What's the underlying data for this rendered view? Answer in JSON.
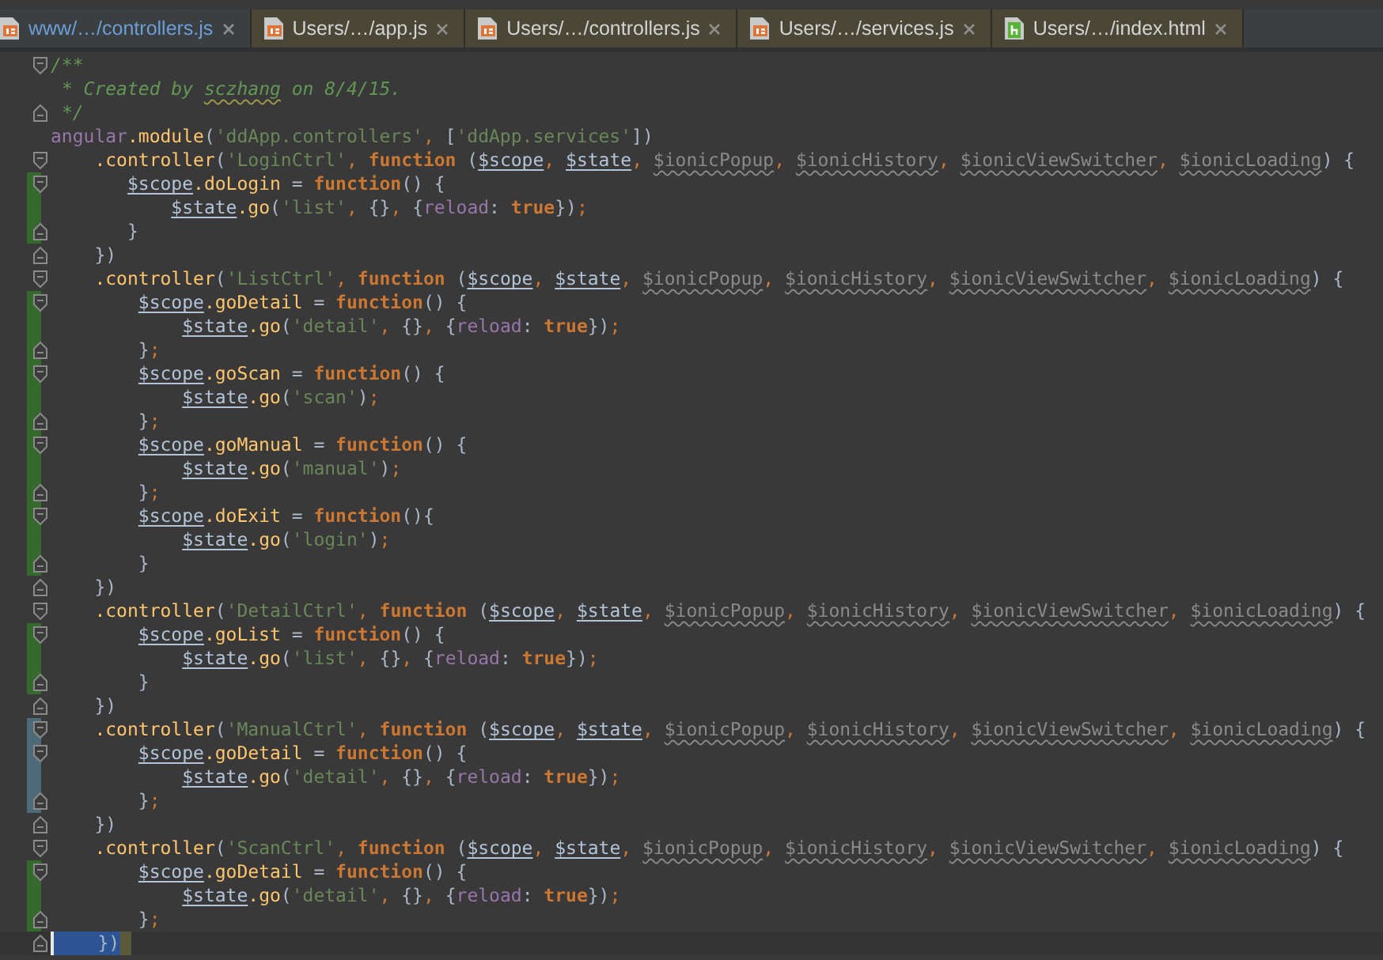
{
  "tabs": [
    {
      "label": "www/…/controllers.js",
      "kind": "js",
      "selected": true
    },
    {
      "label": "Users/…/app.js",
      "kind": "js",
      "selected": false
    },
    {
      "label": "Users/…/controllers.js",
      "kind": "js",
      "selected": false
    },
    {
      "label": "Users/…/services.js",
      "kind": "js",
      "selected": false
    },
    {
      "label": "Users/…/index.html",
      "kind": "html",
      "selected": false
    }
  ],
  "lines": [
    {
      "fold_start": true,
      "selected": false,
      "tokens": [
        {
          "kind": "comment",
          "text": "/**"
        }
      ]
    },
    {
      "selected": false,
      "tokens": [
        {
          "kind": "comment",
          "text": " * Created by "
        },
        {
          "kind": "typo",
          "text": "sczhang"
        },
        {
          "kind": "comment",
          "text": " on 8/4/15."
        }
      ]
    },
    {
      "fold_end": true,
      "selected": false,
      "tokens": [
        {
          "kind": "comment",
          "text": " */"
        }
      ]
    },
    {
      "selected": false,
      "tokens": [
        {
          "kind": "global",
          "text": "angular"
        },
        {
          "kind": "member",
          "text": ".module"
        },
        {
          "kind": "plain",
          "text": "("
        },
        {
          "kind": "string",
          "text": "'ddApp.controllers'"
        },
        {
          "kind": "punct",
          "text": ", "
        },
        {
          "kind": "plain",
          "text": "["
        },
        {
          "kind": "string",
          "text": "'ddApp.services'"
        },
        {
          "kind": "plain",
          "text": "])"
        }
      ]
    },
    {
      "fold_start": true,
      "selected": false,
      "tokens": [
        {
          "kind": "member",
          "text": "    .controller"
        },
        {
          "kind": "plain",
          "text": "("
        },
        {
          "kind": "string",
          "text": "'LoginCtrl'"
        },
        {
          "kind": "punct",
          "text": ", "
        },
        {
          "kind": "keyword",
          "text": "function"
        },
        {
          "kind": "plain",
          "text": " ("
        },
        {
          "kind": "param",
          "text": "$scope"
        },
        {
          "kind": "punct",
          "text": ", "
        },
        {
          "kind": "param",
          "text": "$state"
        },
        {
          "kind": "punct",
          "text": ", "
        },
        {
          "kind": "unused",
          "text": "$ionicPopup"
        },
        {
          "kind": "punct",
          "text": ", "
        },
        {
          "kind": "unused",
          "text": "$ionicHistory"
        },
        {
          "kind": "punct",
          "text": ", "
        },
        {
          "kind": "unused",
          "text": "$ionicViewSwitcher"
        },
        {
          "kind": "punct",
          "text": ", "
        },
        {
          "kind": "unused",
          "text": "$ionicLoading"
        },
        {
          "kind": "plain",
          "text": ") {"
        }
      ]
    },
    {
      "fold_start": true,
      "added": true,
      "selected": false,
      "tokens": [
        {
          "kind": "param",
          "text": "       $scope"
        },
        {
          "kind": "member",
          "text": ".doLogin"
        },
        {
          "kind": "plain",
          "text": " = "
        },
        {
          "kind": "keyword",
          "text": "function"
        },
        {
          "kind": "plain",
          "text": "() {"
        }
      ]
    },
    {
      "added": true,
      "selected": false,
      "tokens": [
        {
          "kind": "param",
          "text": "           $state"
        },
        {
          "kind": "member",
          "text": ".go"
        },
        {
          "kind": "plain",
          "text": "("
        },
        {
          "kind": "string",
          "text": "'list'"
        },
        {
          "kind": "punct",
          "text": ", "
        },
        {
          "kind": "plain",
          "text": "{}"
        },
        {
          "kind": "punct",
          "text": ", "
        },
        {
          "kind": "plain",
          "text": "{"
        },
        {
          "kind": "field",
          "text": "reload"
        },
        {
          "kind": "plain",
          "text": ": "
        },
        {
          "kind": "keyword",
          "text": "true"
        },
        {
          "kind": "plain",
          "text": "})"
        },
        {
          "kind": "punct",
          "text": ";"
        }
      ]
    },
    {
      "fold_end": true,
      "added": true,
      "selected": false,
      "tokens": [
        {
          "kind": "plain",
          "text": "       }"
        }
      ]
    },
    {
      "fold_end": true,
      "selected": false,
      "tokens": [
        {
          "kind": "plain",
          "text": "    })"
        }
      ]
    },
    {
      "fold_start": true,
      "selected": false,
      "tokens": [
        {
          "kind": "member",
          "text": "    .controller"
        },
        {
          "kind": "plain",
          "text": "("
        },
        {
          "kind": "string",
          "text": "'ListCtrl'"
        },
        {
          "kind": "punct",
          "text": ", "
        },
        {
          "kind": "keyword",
          "text": "function"
        },
        {
          "kind": "plain",
          "text": " ("
        },
        {
          "kind": "param",
          "text": "$scope"
        },
        {
          "kind": "punct",
          "text": ", "
        },
        {
          "kind": "param",
          "text": "$state"
        },
        {
          "kind": "punct",
          "text": ", "
        },
        {
          "kind": "unused",
          "text": "$ionicPopup"
        },
        {
          "kind": "punct",
          "text": ", "
        },
        {
          "kind": "unused",
          "text": "$ionicHistory"
        },
        {
          "kind": "punct",
          "text": ", "
        },
        {
          "kind": "unused",
          "text": "$ionicViewSwitcher"
        },
        {
          "kind": "punct",
          "text": ", "
        },
        {
          "kind": "unused",
          "text": "$ionicLoading"
        },
        {
          "kind": "plain",
          "text": ") {"
        }
      ]
    },
    {
      "fold_start": true,
      "added": true,
      "selected": false,
      "tokens": [
        {
          "kind": "param",
          "text": "        $scope"
        },
        {
          "kind": "member",
          "text": ".goDetail"
        },
        {
          "kind": "plain",
          "text": " = "
        },
        {
          "kind": "keyword",
          "text": "function"
        },
        {
          "kind": "plain",
          "text": "() {"
        }
      ]
    },
    {
      "added": true,
      "selected": false,
      "tokens": [
        {
          "kind": "param",
          "text": "            $state"
        },
        {
          "kind": "member",
          "text": ".go"
        },
        {
          "kind": "plain",
          "text": "("
        },
        {
          "kind": "string",
          "text": "'detail'"
        },
        {
          "kind": "punct",
          "text": ", "
        },
        {
          "kind": "plain",
          "text": "{}"
        },
        {
          "kind": "punct",
          "text": ", "
        },
        {
          "kind": "plain",
          "text": "{"
        },
        {
          "kind": "field",
          "text": "reload"
        },
        {
          "kind": "plain",
          "text": ": "
        },
        {
          "kind": "keyword",
          "text": "true"
        },
        {
          "kind": "plain",
          "text": "})"
        },
        {
          "kind": "punct",
          "text": ";"
        }
      ]
    },
    {
      "fold_end": true,
      "added": true,
      "selected": false,
      "tokens": [
        {
          "kind": "plain",
          "text": "        }"
        },
        {
          "kind": "punct",
          "text": ";"
        }
      ]
    },
    {
      "fold_start": true,
      "added": true,
      "selected": false,
      "tokens": [
        {
          "kind": "param",
          "text": "        $scope"
        },
        {
          "kind": "member",
          "text": ".goScan"
        },
        {
          "kind": "plain",
          "text": " = "
        },
        {
          "kind": "keyword",
          "text": "function"
        },
        {
          "kind": "plain",
          "text": "() {"
        }
      ]
    },
    {
      "added": true,
      "selected": false,
      "tokens": [
        {
          "kind": "param",
          "text": "            $state"
        },
        {
          "kind": "member",
          "text": ".go"
        },
        {
          "kind": "plain",
          "text": "("
        },
        {
          "kind": "string",
          "text": "'scan'"
        },
        {
          "kind": "plain",
          "text": ")"
        },
        {
          "kind": "punct",
          "text": ";"
        }
      ]
    },
    {
      "fold_end": true,
      "added": true,
      "selected": false,
      "tokens": [
        {
          "kind": "plain",
          "text": "        }"
        },
        {
          "kind": "punct",
          "text": ";"
        }
      ]
    },
    {
      "fold_start": true,
      "added": true,
      "selected": false,
      "tokens": [
        {
          "kind": "param",
          "text": "        $scope"
        },
        {
          "kind": "member",
          "text": ".goManual"
        },
        {
          "kind": "plain",
          "text": " = "
        },
        {
          "kind": "keyword",
          "text": "function"
        },
        {
          "kind": "plain",
          "text": "() {"
        }
      ]
    },
    {
      "added": true,
      "selected": false,
      "tokens": [
        {
          "kind": "param",
          "text": "            $state"
        },
        {
          "kind": "member",
          "text": ".go"
        },
        {
          "kind": "plain",
          "text": "("
        },
        {
          "kind": "string",
          "text": "'manual'"
        },
        {
          "kind": "plain",
          "text": ")"
        },
        {
          "kind": "punct",
          "text": ";"
        }
      ]
    },
    {
      "fold_end": true,
      "added": true,
      "selected": false,
      "tokens": [
        {
          "kind": "plain",
          "text": "        }"
        },
        {
          "kind": "punct",
          "text": ";"
        }
      ]
    },
    {
      "fold_start": true,
      "added": true,
      "selected": false,
      "tokens": [
        {
          "kind": "param",
          "text": "        $scope"
        },
        {
          "kind": "member",
          "text": ".doExit"
        },
        {
          "kind": "plain",
          "text": " = "
        },
        {
          "kind": "keyword",
          "text": "function"
        },
        {
          "kind": "plain",
          "text": "(){"
        }
      ]
    },
    {
      "added": true,
      "selected": false,
      "tokens": [
        {
          "kind": "param",
          "text": "            $state"
        },
        {
          "kind": "member",
          "text": ".go"
        },
        {
          "kind": "plain",
          "text": "("
        },
        {
          "kind": "string",
          "text": "'login'"
        },
        {
          "kind": "plain",
          "text": ")"
        },
        {
          "kind": "punct",
          "text": ";"
        }
      ]
    },
    {
      "fold_end": true,
      "added": true,
      "selected": false,
      "tokens": [
        {
          "kind": "plain",
          "text": "        }"
        }
      ]
    },
    {
      "fold_end": true,
      "selected": false,
      "tokens": [
        {
          "kind": "plain",
          "text": "    })"
        }
      ]
    },
    {
      "fold_start": true,
      "selected": false,
      "tokens": [
        {
          "kind": "member",
          "text": "    .controller"
        },
        {
          "kind": "plain",
          "text": "("
        },
        {
          "kind": "string",
          "text": "'DetailCtrl'"
        },
        {
          "kind": "punct",
          "text": ", "
        },
        {
          "kind": "keyword",
          "text": "function"
        },
        {
          "kind": "plain",
          "text": " ("
        },
        {
          "kind": "param",
          "text": "$scope"
        },
        {
          "kind": "punct",
          "text": ", "
        },
        {
          "kind": "param",
          "text": "$state"
        },
        {
          "kind": "punct",
          "text": ", "
        },
        {
          "kind": "unused",
          "text": "$ionicPopup"
        },
        {
          "kind": "punct",
          "text": ", "
        },
        {
          "kind": "unused",
          "text": "$ionicHistory"
        },
        {
          "kind": "punct",
          "text": ", "
        },
        {
          "kind": "unused",
          "text": "$ionicViewSwitcher"
        },
        {
          "kind": "punct",
          "text": ", "
        },
        {
          "kind": "unused",
          "text": "$ionicLoading"
        },
        {
          "kind": "plain",
          "text": ") {"
        }
      ]
    },
    {
      "fold_start": true,
      "added": true,
      "selected": false,
      "tokens": [
        {
          "kind": "param",
          "text": "        $scope"
        },
        {
          "kind": "member",
          "text": ".goList"
        },
        {
          "kind": "plain",
          "text": " = "
        },
        {
          "kind": "keyword",
          "text": "function"
        },
        {
          "kind": "plain",
          "text": "() {"
        }
      ]
    },
    {
      "added": true,
      "selected": false,
      "tokens": [
        {
          "kind": "param",
          "text": "            $state"
        },
        {
          "kind": "member",
          "text": ".go"
        },
        {
          "kind": "plain",
          "text": "("
        },
        {
          "kind": "string",
          "text": "'list'"
        },
        {
          "kind": "punct",
          "text": ", "
        },
        {
          "kind": "plain",
          "text": "{}"
        },
        {
          "kind": "punct",
          "text": ", "
        },
        {
          "kind": "plain",
          "text": "{"
        },
        {
          "kind": "field",
          "text": "reload"
        },
        {
          "kind": "plain",
          "text": ": "
        },
        {
          "kind": "keyword",
          "text": "true"
        },
        {
          "kind": "plain",
          "text": "})"
        },
        {
          "kind": "punct",
          "text": ";"
        }
      ]
    },
    {
      "fold_end": true,
      "added": true,
      "selected": false,
      "tokens": [
        {
          "kind": "plain",
          "text": "        }"
        }
      ]
    },
    {
      "fold_end": true,
      "selected": false,
      "tokens": [
        {
          "kind": "plain",
          "text": "    })"
        }
      ]
    },
    {
      "fold_start": true,
      "modified": true,
      "selected": false,
      "tokens": [
        {
          "kind": "member",
          "text": "    .controller"
        },
        {
          "kind": "plain",
          "text": "("
        },
        {
          "kind": "string",
          "text": "'ManualCtrl'"
        },
        {
          "kind": "punct",
          "text": ", "
        },
        {
          "kind": "keyword",
          "text": "function"
        },
        {
          "kind": "plain",
          "text": " ("
        },
        {
          "kind": "param",
          "text": "$scope"
        },
        {
          "kind": "punct",
          "text": ", "
        },
        {
          "kind": "param",
          "text": "$state"
        },
        {
          "kind": "punct",
          "text": ", "
        },
        {
          "kind": "unused",
          "text": "$ionicPopup"
        },
        {
          "kind": "punct",
          "text": ", "
        },
        {
          "kind": "unused",
          "text": "$ionicHistory"
        },
        {
          "kind": "punct",
          "text": ", "
        },
        {
          "kind": "unused",
          "text": "$ionicViewSwitcher"
        },
        {
          "kind": "punct",
          "text": ", "
        },
        {
          "kind": "unused",
          "text": "$ionicLoading"
        },
        {
          "kind": "plain",
          "text": ") {"
        }
      ]
    },
    {
      "fold_start": true,
      "modified": true,
      "selected": false,
      "tokens": [
        {
          "kind": "param",
          "text": "        $scope"
        },
        {
          "kind": "member",
          "text": ".goDetail"
        },
        {
          "kind": "plain",
          "text": " = "
        },
        {
          "kind": "keyword",
          "text": "function"
        },
        {
          "kind": "plain",
          "text": "() {"
        }
      ]
    },
    {
      "modified": true,
      "selected": false,
      "tokens": [
        {
          "kind": "param",
          "text": "            $state"
        },
        {
          "kind": "member",
          "text": ".go"
        },
        {
          "kind": "plain",
          "text": "("
        },
        {
          "kind": "string",
          "text": "'detail'"
        },
        {
          "kind": "punct",
          "text": ", "
        },
        {
          "kind": "plain",
          "text": "{}"
        },
        {
          "kind": "punct",
          "text": ", "
        },
        {
          "kind": "plain",
          "text": "{"
        },
        {
          "kind": "field",
          "text": "reload"
        },
        {
          "kind": "plain",
          "text": ": "
        },
        {
          "kind": "keyword",
          "text": "true"
        },
        {
          "kind": "plain",
          "text": "})"
        },
        {
          "kind": "punct",
          "text": ";"
        }
      ]
    },
    {
      "fold_end": true,
      "modified": true,
      "selected": false,
      "tokens": [
        {
          "kind": "plain",
          "text": "        }"
        },
        {
          "kind": "punct",
          "text": ";"
        }
      ]
    },
    {
      "fold_end": true,
      "selected": false,
      "tokens": [
        {
          "kind": "plain",
          "text": "    })"
        }
      ]
    },
    {
      "fold_start": true,
      "selected": false,
      "tokens": [
        {
          "kind": "member",
          "text": "    .controller"
        },
        {
          "kind": "plain",
          "text": "("
        },
        {
          "kind": "string",
          "text": "'ScanCtrl'"
        },
        {
          "kind": "punct",
          "text": ", "
        },
        {
          "kind": "keyword",
          "text": "function"
        },
        {
          "kind": "plain",
          "text": " ("
        },
        {
          "kind": "param",
          "text": "$scope"
        },
        {
          "kind": "punct",
          "text": ", "
        },
        {
          "kind": "param",
          "text": "$state"
        },
        {
          "kind": "punct",
          "text": ", "
        },
        {
          "kind": "unused",
          "text": "$ionicPopup"
        },
        {
          "kind": "punct",
          "text": ", "
        },
        {
          "kind": "unused",
          "text": "$ionicHistory"
        },
        {
          "kind": "punct",
          "text": ", "
        },
        {
          "kind": "unused",
          "text": "$ionicViewSwitcher"
        },
        {
          "kind": "punct",
          "text": ", "
        },
        {
          "kind": "unused",
          "text": "$ionicLoading"
        },
        {
          "kind": "plain",
          "text": ") {"
        }
      ]
    },
    {
      "fold_start": true,
      "added": true,
      "selected": false,
      "tokens": [
        {
          "kind": "param",
          "text": "        $scope"
        },
        {
          "kind": "member",
          "text": ".goDetail"
        },
        {
          "kind": "plain",
          "text": " = "
        },
        {
          "kind": "keyword",
          "text": "function"
        },
        {
          "kind": "plain",
          "text": "() {"
        }
      ]
    },
    {
      "added": true,
      "selected": false,
      "tokens": [
        {
          "kind": "param",
          "text": "            $state"
        },
        {
          "kind": "member",
          "text": ".go"
        },
        {
          "kind": "plain",
          "text": "("
        },
        {
          "kind": "string",
          "text": "'detail'"
        },
        {
          "kind": "punct",
          "text": ", "
        },
        {
          "kind": "plain",
          "text": "{}"
        },
        {
          "kind": "punct",
          "text": ", "
        },
        {
          "kind": "plain",
          "text": "{"
        },
        {
          "kind": "field",
          "text": "reload"
        },
        {
          "kind": "plain",
          "text": ": "
        },
        {
          "kind": "keyword",
          "text": "true"
        },
        {
          "kind": "plain",
          "text": "})"
        },
        {
          "kind": "punct",
          "text": ";"
        }
      ]
    },
    {
      "fold_end": true,
      "added": true,
      "selected": false,
      "tokens": [
        {
          "kind": "plain",
          "text": "        }"
        },
        {
          "kind": "punct",
          "text": ";"
        }
      ]
    },
    {
      "fold_end": true,
      "selected": true,
      "tokens": [
        {
          "kind": "plain",
          "text": "    })"
        }
      ]
    }
  ]
}
